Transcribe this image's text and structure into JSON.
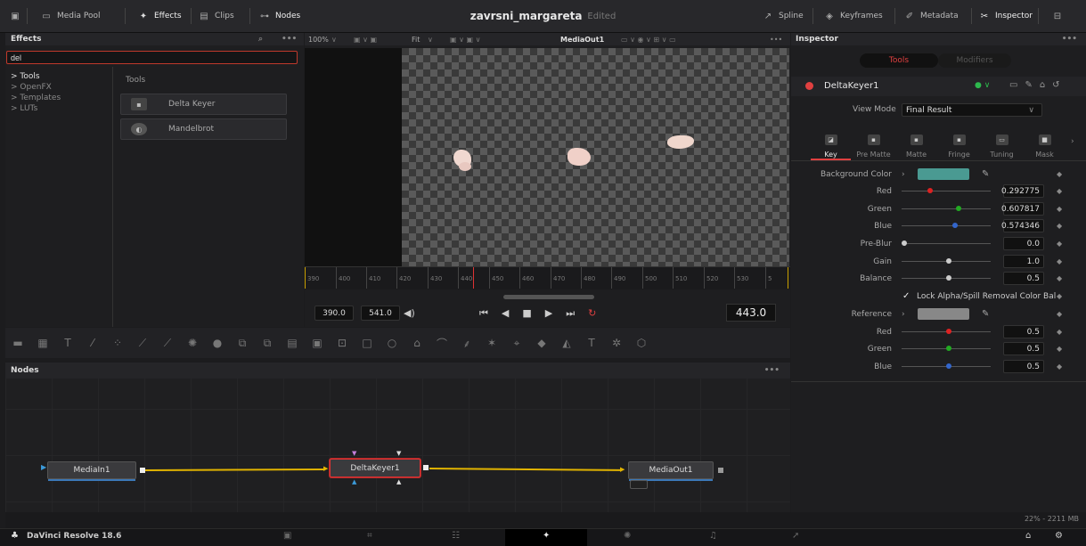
{
  "topbar": {
    "media_pool": "Media Pool",
    "effects": "Effects",
    "clips": "Clips",
    "nodes": "Nodes",
    "project": "zavrsni_margareta",
    "edited": "Edited",
    "spline": "Spline",
    "keyframes": "Keyframes",
    "metadata": "Metadata",
    "inspector": "Inspector"
  },
  "effects": {
    "title": "Effects",
    "search_value": "del",
    "tree": [
      "Tools",
      "OpenFX",
      "Templates",
      "LUTs"
    ],
    "tools_title": "Tools",
    "items": [
      "Delta Keyer",
      "Mandelbrot"
    ]
  },
  "viewer": {
    "zoom": "100%",
    "fit": "Fit",
    "output": "MediaOut1",
    "ruler": [
      "390",
      "400",
      "410",
      "420",
      "430",
      "440",
      "450",
      "460",
      "470",
      "480",
      "490",
      "500",
      "510",
      "520",
      "530",
      "5"
    ],
    "tc_in": "390.0",
    "tc_out": "541.0",
    "tc_current": "443.0"
  },
  "nodes": {
    "title": "Nodes",
    "items": [
      "MediaIn1",
      "DeltaKeyer1",
      "MediaOut1"
    ]
  },
  "inspector": {
    "title": "Inspector",
    "seg_tools": "Tools",
    "seg_modifiers": "Modifiers",
    "node_name": "DeltaKeyer1",
    "view_mode_label": "View Mode",
    "view_mode_value": "Final Result",
    "tabs": [
      "Key",
      "Pre Matte",
      "Matte",
      "Fringe",
      "Tuning",
      "Mask"
    ],
    "background_color_label": "Background Color",
    "bg_swatch": "#4a9a92",
    "red_label": "Red",
    "red_value": "0.292775",
    "green_label": "Green",
    "green_value": "0.607817",
    "blue_label": "Blue",
    "blue_value": "0.574346",
    "preblur_label": "Pre-Blur",
    "preblur_value": "0.0",
    "gain_label": "Gain",
    "gain_value": "1.0",
    "balance_label": "Balance",
    "balance_value": "0.5",
    "lock_label": "Lock Alpha/Spill Removal Color Bal",
    "reference_label": "Reference",
    "ref_red_label": "Red",
    "ref_red_value": "0.5",
    "ref_green_label": "Green",
    "ref_green_value": "0.5",
    "ref_blue_label": "Blue",
    "ref_blue_value": "0.5"
  },
  "status": {
    "memory": "22% - 2211 MB"
  },
  "app": {
    "name": "DaVinci Resolve 18.6"
  }
}
